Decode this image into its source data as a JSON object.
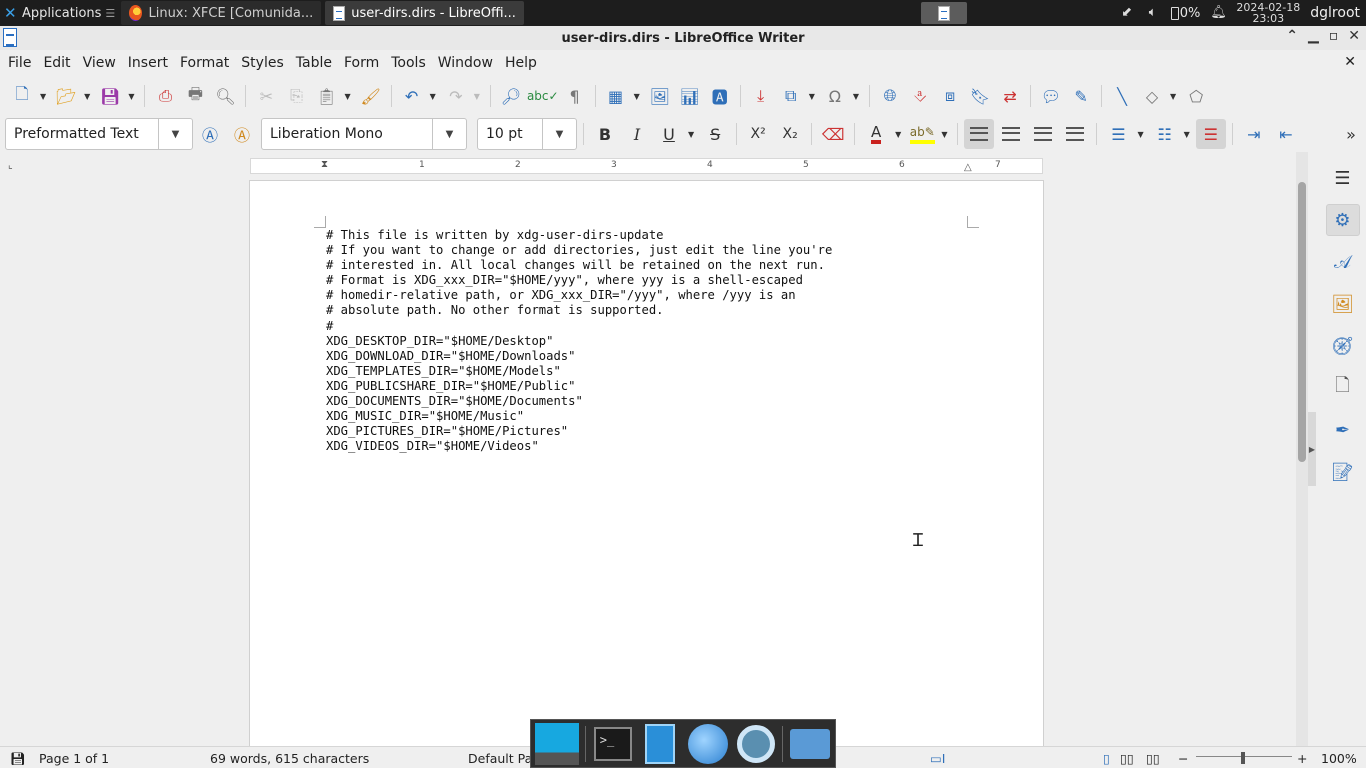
{
  "panel": {
    "applications_label": "Applications",
    "tasks": [
      {
        "label": "Linux: XFCE [Comunida..."
      },
      {
        "label": "user-dirs.dirs - LibreOffi..."
      }
    ],
    "battery": "0%",
    "clock_date": "2024-02-18",
    "clock_time": "23:03",
    "user": "dglroot"
  },
  "window": {
    "title": "user-dirs.dirs - LibreOffice Writer"
  },
  "menu": {
    "items": [
      "File",
      "Edit",
      "View",
      "Insert",
      "Format",
      "Styles",
      "Table",
      "Form",
      "Tools",
      "Window",
      "Help"
    ]
  },
  "format_toolbar": {
    "paragraph_style": "Preformatted Text",
    "font_name": "Liberation Mono",
    "font_size": "10 pt",
    "bold": "B",
    "italic": "I",
    "underline": "U",
    "strike": "S",
    "superscript": "X²",
    "subscript": "X₂",
    "font_color": "#c9211e",
    "highlight_color": "#ffff00"
  },
  "ruler": {
    "marks": [
      "1",
      "2",
      "3",
      "4",
      "5",
      "6",
      "7"
    ]
  },
  "document": {
    "lines": [
      "# This file is written by xdg-user-dirs-update",
      "# If you want to change or add directories, just edit the line you're",
      "# interested in. All local changes will be retained on the next run.",
      "# Format is XDG_xxx_DIR=\"$HOME/yyy\", where yyy is a shell-escaped",
      "# homedir-relative path, or XDG_xxx_DIR=\"/yyy\", where /yyy is an",
      "# absolute path. No other format is supported.",
      "#",
      "XDG_DESKTOP_DIR=\"$HOME/Desktop\"",
      "XDG_DOWNLOAD_DIR=\"$HOME/Downloads\"",
      "XDG_TEMPLATES_DIR=\"$HOME/Models\"",
      "XDG_PUBLICSHARE_DIR=\"$HOME/Public\"",
      "XDG_DOCUMENTS_DIR=\"$HOME/Documents\"",
      "XDG_MUSIC_DIR=\"$HOME/Music\"",
      "XDG_PICTURES_DIR=\"$HOME/Pictures\"",
      "XDG_VIDEOS_DIR=\"$HOME/Videos\""
    ]
  },
  "status": {
    "page": "Page 1 of 1",
    "words": "69 words, 615 characters",
    "page_style": "Default Pa",
    "zoom": "100%"
  }
}
